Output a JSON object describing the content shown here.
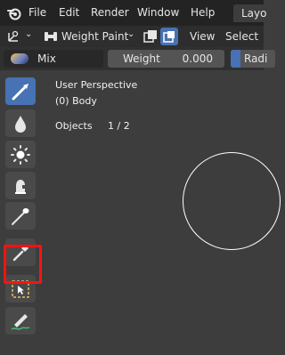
{
  "menubar": {
    "items": [
      "File",
      "Edit",
      "Render",
      "Window",
      "Help"
    ],
    "workspace_tab": "Layo"
  },
  "header": {
    "mode": "Weight Paint",
    "view_menu": "View",
    "select_menu": "Select"
  },
  "tool_settings": {
    "brush_name": "Mix",
    "weight_label": "Weight",
    "weight_value": "0.000",
    "radius_label": "Radi"
  },
  "viewport": {
    "perspective": "User Perspective",
    "object_name": "(0) Body",
    "objects_label": "Objects",
    "objects_value": "1 / 2"
  },
  "toolbar": {
    "tools": [
      "draw-tool",
      "blur-tool",
      "average-tool",
      "smear-tool",
      "gradient-tool",
      "sample-weight-tool",
      "select-box-tool",
      "annotate-tool"
    ],
    "active_tool": "draw-tool",
    "highlighted_tool": "select-box-tool"
  },
  "colors": {
    "accent": "#4772b3",
    "highlight": "#ff1111",
    "background": "#3d3d3d"
  }
}
